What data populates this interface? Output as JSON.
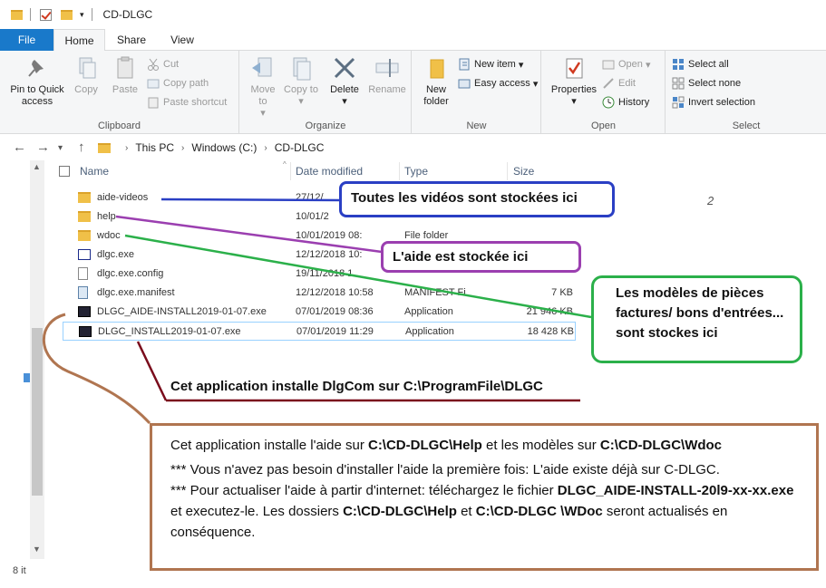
{
  "window": {
    "title": "CD-DLGC"
  },
  "tabs": {
    "file": "File",
    "home": "Home",
    "share": "Share",
    "view": "View"
  },
  "ribbon": {
    "clipboard": {
      "label": "Clipboard",
      "pin": "Pin to Quick access",
      "copy": "Copy",
      "paste": "Paste",
      "cut": "Cut",
      "copy_path": "Copy path",
      "paste_shortcut": "Paste shortcut"
    },
    "organize": {
      "label": "Organize",
      "move_to": "Move to",
      "copy_to": "Copy to",
      "delete": "Delete",
      "rename": "Rename"
    },
    "new": {
      "label": "New",
      "new_folder": "New folder",
      "new_item": "New item",
      "easy_access": "Easy access"
    },
    "open": {
      "label": "Open",
      "properties": "Properties",
      "open": "Open",
      "edit": "Edit",
      "history": "History"
    },
    "select": {
      "label": "Select",
      "select_all": "Select all",
      "select_none": "Select none",
      "invert": "Invert selection"
    }
  },
  "address": {
    "crumbs": [
      "This PC",
      "Windows (C:)",
      "CD-DLGC"
    ]
  },
  "columns": {
    "name": "Name",
    "date": "Date modified",
    "type": "Type",
    "size": "Size"
  },
  "files": [
    {
      "name": "aide-videos",
      "date": "27/12/",
      "type": "",
      "size": ""
    },
    {
      "name": "help",
      "date": "10/01/2",
      "type": "",
      "size": ""
    },
    {
      "name": "wdoc",
      "date": "10/01/2019 08:",
      "type": "File folder",
      "size": ""
    },
    {
      "name": "dlgc.exe",
      "date": "12/12/2018 10:",
      "type": "",
      "size": ""
    },
    {
      "name": "dlgc.exe.config",
      "date": "19/11/2018 1",
      "type": "",
      "size": ""
    },
    {
      "name": "dlgc.exe.manifest",
      "date": "12/12/2018 10:58",
      "type": "MANIFEST Fi",
      "size": "7 KB"
    },
    {
      "name": "DLGC_AIDE-INSTALL2019-01-07.exe",
      "date": "07/01/2019 08:36",
      "type": "Application",
      "size": "21 946 KB"
    },
    {
      "name": "DLGC_INSTALL2019-01-07.exe",
      "date": "07/01/2019 11:29",
      "type": "Application",
      "size": "18 428 KB"
    }
  ],
  "status": {
    "items": "8 it"
  },
  "annotations": {
    "videos": "Toutes les vidéos sont stockées ici",
    "help": "L'aide est stockée ici",
    "wdoc": "Les modèles de pièces factures/ bons d'entrées... sont stockes ici",
    "installer": "Cet application installe DlgCom sur C:\\ProgramFile\\DLGC",
    "page_number": "2",
    "note_line1_a": "Cet application installe l'aide sur ",
    "note_line1_b": "C:\\CD-DLGC\\Help",
    "note_line1_c": " et les modèles sur ",
    "note_line1_d": "C:\\CD-DLGC\\Wdoc",
    "note_line2": "*** Vous n'avez pas besoin d'installer l'aide la première fois: L'aide existe déjà sur  C-DLGC.",
    "note_line3_a": "*** Pour actualiser l'aide à partir d'internet: téléchargez le fichier ",
    "note_line3_b": "DLGC_AIDE-INSTALL-20l9-xx-xx.exe",
    "note_line3_c": " et executez-le.  Les dossiers ",
    "note_line3_d": "C:\\CD-DLGC\\Help",
    "note_line3_e": " et ",
    "note_line3_f": "C:\\CD-DLGC \\WDoc",
    "note_line3_g": " seront actualisés en conséquence."
  }
}
